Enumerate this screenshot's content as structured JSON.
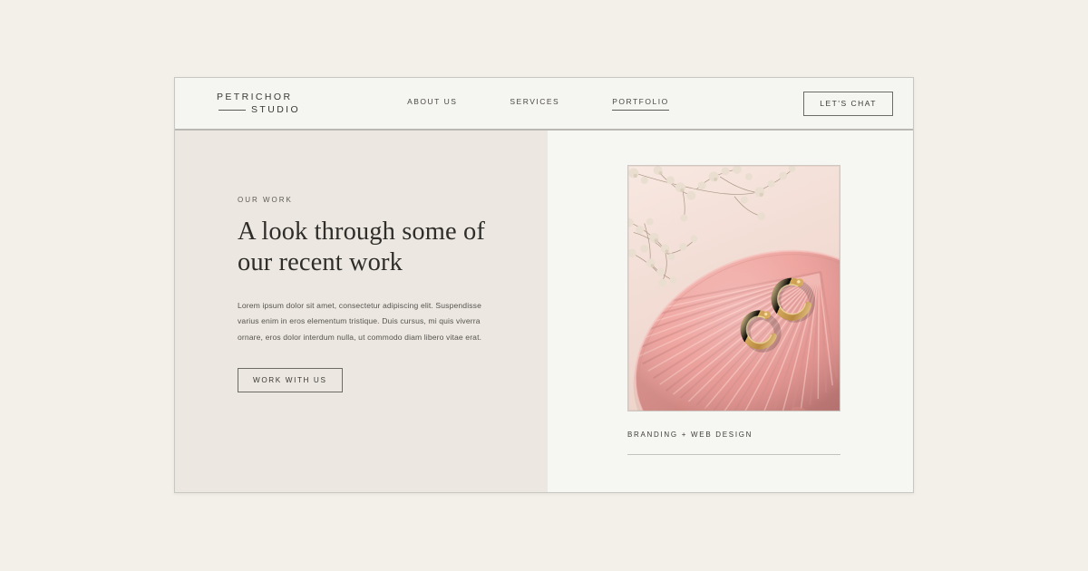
{
  "page": {
    "background_color": "#f3f0ea",
    "card_background": "#f5f5f2"
  },
  "header": {
    "logo": {
      "line1": "PETRICHOR",
      "line2": "STUDIO"
    },
    "nav": [
      {
        "label": "ABOUT US",
        "active": false
      },
      {
        "label": "SERVICES",
        "active": false
      },
      {
        "label": "PORTFOLIO",
        "active": true
      }
    ],
    "cta_label": "LET'S CHAT"
  },
  "hero": {
    "eyebrow": "OUR WORK",
    "headline": "A look through some of our recent work",
    "body": "Lorem ipsum dolor sit amet, consectetur adipiscing elit. Suspendisse varius enim in eros elementum tristique. Duis cursus, mi quis viverra ornare, eros dolor interdum nulla, ut commodo diam libero vitae erat.",
    "cta_label": "WORK WITH US"
  },
  "project": {
    "caption": "BRANDING + WEB DESIGN",
    "image_alt": "pink fluted ceramic dish with gold hoop earrings and dried baby's breath",
    "palette": {
      "backdrop": "#f3e3dc",
      "dish_light": "#f0a9a4",
      "dish_mid": "#e59a96",
      "dish_dark": "#cf8683",
      "dish_ridge": "#f7bdb8",
      "gold": "#c99a50",
      "gold_light": "#e8c98b",
      "flower": "#e8ddcf",
      "stem": "#9d8974"
    }
  },
  "colors": {
    "panel_left": "#ece8e1",
    "panel_right": "#f6f6f3",
    "text_dark": "#2f2d2a",
    "text_muted": "#56534f",
    "border": "#c9c7c2",
    "divider": "#bab8b3"
  }
}
